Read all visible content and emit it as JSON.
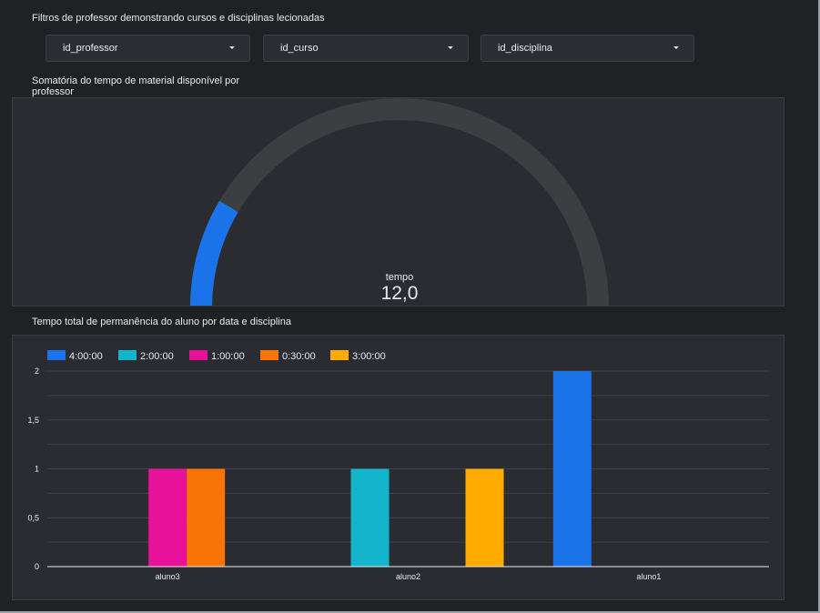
{
  "filters": {
    "title": "Filtros de professor demonstrando cursos e disciplinas lecionadas",
    "dropdowns": [
      {
        "label": "id_professor"
      },
      {
        "label": "id_curso"
      },
      {
        "label": "id_disciplina"
      }
    ]
  },
  "gauge": {
    "title_line1": "Somatória do tempo de material disponível por",
    "title_line2": "professor",
    "metric_name": "tempo",
    "value_text": "12,0",
    "fill_fraction": 0.17,
    "fill_color": "#1a73e8",
    "track_color": "#3c3f41"
  },
  "chart_title": "Tempo total de permanência do aluno por data e disciplina",
  "chart_data": {
    "type": "bar",
    "categories": [
      "aluno3",
      "aluno2",
      "aluno1"
    ],
    "series": [
      {
        "name": "4:00:00",
        "color": "#1a73e8",
        "values": [
          0,
          0,
          2
        ]
      },
      {
        "name": "2:00:00",
        "color": "#12b5cb",
        "values": [
          0,
          1,
          0
        ]
      },
      {
        "name": "1:00:00",
        "color": "#e8119a",
        "values": [
          1,
          0,
          0
        ]
      },
      {
        "name": "0:30:00",
        "color": "#f97406",
        "values": [
          1,
          0,
          0
        ]
      },
      {
        "name": "3:00:00",
        "color": "#ffab00",
        "values": [
          0,
          1,
          0
        ]
      }
    ],
    "ylim": [
      0,
      2
    ],
    "yticks": [
      {
        "value": 0,
        "label": "0"
      },
      {
        "value": 0.5,
        "label": "0,5"
      },
      {
        "value": 1,
        "label": "1"
      },
      {
        "value": 1.5,
        "label": "1,5"
      },
      {
        "value": 2,
        "label": "2"
      }
    ],
    "grid": true,
    "legend": "top-left"
  }
}
